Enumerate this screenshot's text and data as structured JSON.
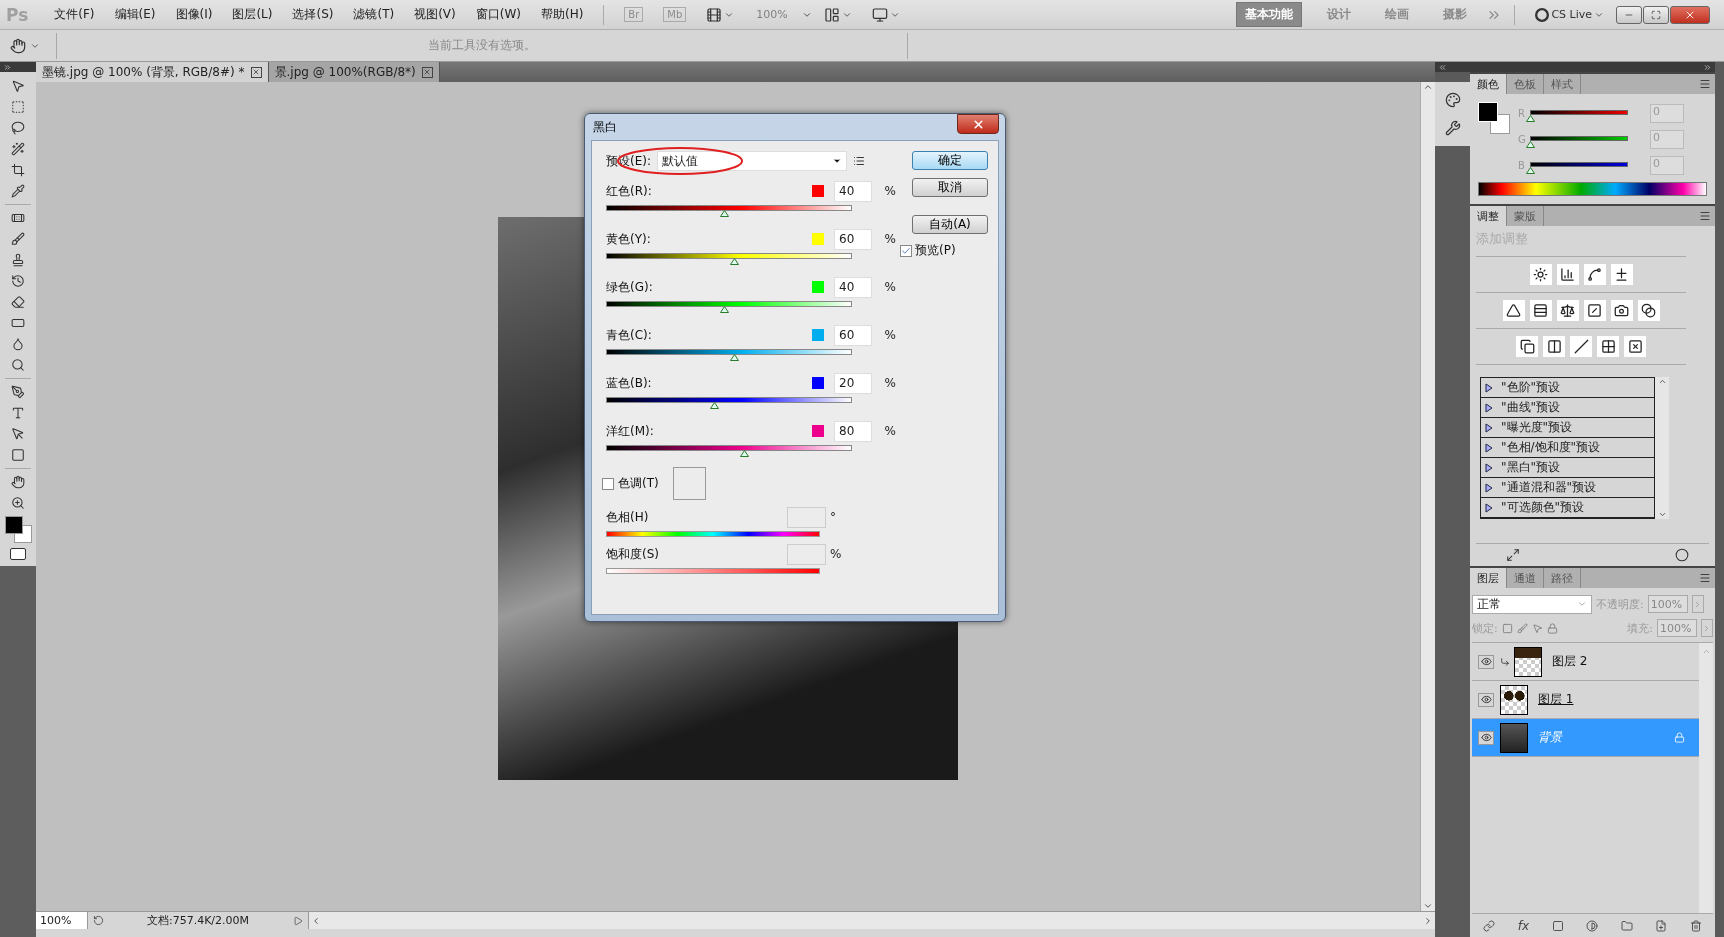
{
  "app_logo": "Ps",
  "menu_bar": [
    "文件(F)",
    "编辑(E)",
    "图像(I)",
    "图层(L)",
    "选择(S)",
    "滤镜(T)",
    "视图(V)",
    "窗口(W)",
    "帮助(H)"
  ],
  "app_buttons": [
    {
      "label": "Br",
      "disabled": true
    },
    {
      "label": "Mb",
      "disabled": true
    }
  ],
  "zoom_menu": {
    "label": "100%",
    "disabled": true
  },
  "workspaces": [
    {
      "label": "基本功能",
      "selected": true
    },
    {
      "label": "设计",
      "selected": false
    },
    {
      "label": "绘画",
      "selected": false
    },
    {
      "label": "摄影",
      "selected": false
    }
  ],
  "cs_live": "CS Live",
  "options_bar": {
    "message": "当前工具没有选项。"
  },
  "document_tabs": [
    {
      "label": "墨镜.jpg @ 100% (背景, RGB/8#) *",
      "selected": true
    },
    {
      "label": "景.jpg @ 100%(RGB/8*)",
      "selected": false
    }
  ],
  "dialog": {
    "title": "黑白",
    "preset_label": "预设(E):",
    "preset_value": "默认值",
    "channels": [
      {
        "label": "红色(R):",
        "color": "#ff0000",
        "value": "40",
        "level": 0.48
      },
      {
        "label": "黄色(Y):",
        "color": "#ffff00",
        "value": "60",
        "level": 0.52
      },
      {
        "label": "绿色(G):",
        "color": "#00ff00",
        "value": "40",
        "level": 0.48
      },
      {
        "label": "青色(C):",
        "color": "#00aeef",
        "value": "60",
        "level": 0.52
      },
      {
        "label": "蓝色(B):",
        "color": "#0000ff",
        "value": "20",
        "level": 0.44
      },
      {
        "label": "洋红(M):",
        "color": "#ec008c",
        "value": "80",
        "level": 0.56
      }
    ],
    "percent": "%",
    "buttons": [
      {
        "label": "确定",
        "kind": "default"
      },
      {
        "label": "取消",
        "kind": "normal"
      },
      {
        "label": "自动(A)",
        "kind": "normal"
      }
    ],
    "preview": {
      "label": "预览(P)",
      "checked": true
    },
    "tint": {
      "label": "色调(T)",
      "checked": false
    },
    "hue": {
      "label": "色相(H)",
      "unit": "°"
    },
    "saturation": {
      "label": "饱和度(S)",
      "unit": "%"
    }
  },
  "color_panel": {
    "tabs": [
      {
        "label": "颜色",
        "selected": true
      },
      {
        "label": "色板",
        "selected": false
      },
      {
        "label": "样式",
        "selected": false
      }
    ],
    "sliders": [
      {
        "label": "R",
        "value": "0",
        "level": 0
      },
      {
        "label": "G",
        "value": "0",
        "level": 0
      },
      {
        "label": "B",
        "value": "0",
        "level": 0
      }
    ]
  },
  "adjustments_panel": {
    "tabs": [
      {
        "label": "调整",
        "selected": true
      },
      {
        "label": "蒙版",
        "selected": false
      }
    ],
    "heading": "添加调整",
    "presets": [
      "\"色阶\"预设",
      "\"曲线\"预设",
      "\"曝光度\"预设",
      "\"色相/饱和度\"预设",
      "\"黑白\"预设",
      "\"通道混和器\"预设",
      "\"可选颜色\"预设"
    ]
  },
  "layers_panel": {
    "tabs": [
      {
        "label": "图层",
        "selected": true
      },
      {
        "label": "通道",
        "selected": false
      },
      {
        "label": "路径",
        "selected": false
      }
    ],
    "blend_mode": "正常",
    "opacity_label": "不透明度:",
    "opacity": "100%",
    "lock_label": "锁定:",
    "fill_label": "填充:",
    "fill": "100%",
    "layers": [
      {
        "name": "图层 2",
        "kind": "sunglasses-top",
        "visible": true,
        "selected": false,
        "clipped": true,
        "locked": false,
        "underlined": false
      },
      {
        "name": "图层 1",
        "kind": "lenses",
        "visible": true,
        "selected": false,
        "clipped": false,
        "locked": false,
        "underlined": true
      },
      {
        "name": "背景",
        "kind": "photo",
        "visible": true,
        "selected": true,
        "clipped": false,
        "locked": true,
        "underlined": false
      }
    ],
    "footer_fx": "fx"
  },
  "status_bar": {
    "zoom": "100%",
    "document": "文档:757.4K/2.00M"
  }
}
